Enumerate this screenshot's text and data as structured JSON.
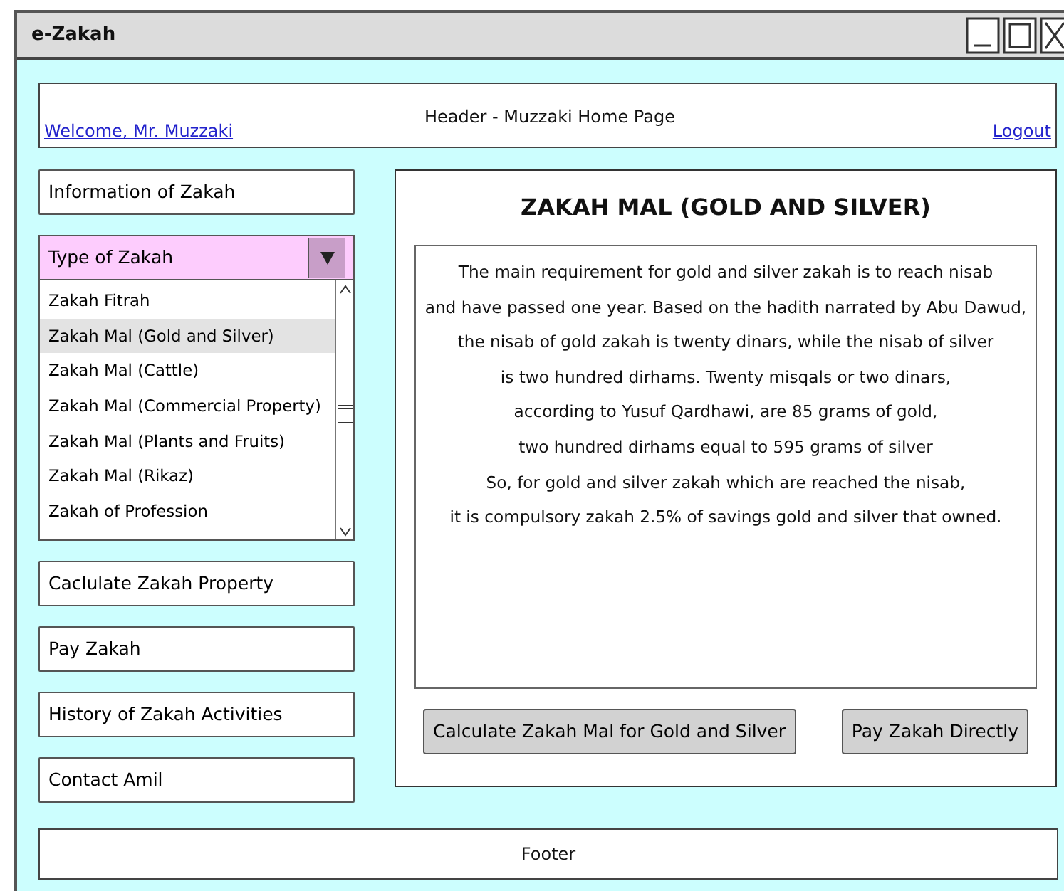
{
  "window": {
    "title": "e-Zakah"
  },
  "header": {
    "welcome_link": "Welcome, Mr. Muzzaki",
    "title": "Header - Muzzaki Home Page",
    "logout_link": "Logout"
  },
  "sidebar": {
    "items": [
      {
        "kind": "button",
        "label": "Information of Zakah"
      },
      {
        "kind": "dropdown",
        "label": "Type of Zakah",
        "expanded": true,
        "options": [
          {
            "label": "Zakah Fitrah",
            "selected": false
          },
          {
            "label": "Zakah Mal (Gold and Silver)",
            "selected": true
          },
          {
            "label": "Zakah Mal (Cattle)",
            "selected": false
          },
          {
            "label": "Zakah Mal (Commercial Property)",
            "selected": false
          },
          {
            "label": "Zakah Mal (Plants and Fruits)",
            "selected": false
          },
          {
            "label": "Zakah Mal (Rikaz)",
            "selected": false
          },
          {
            "label": "Zakah of Profession",
            "selected": false
          }
        ]
      },
      {
        "kind": "button",
        "label": "Caclulate Zakah Property"
      },
      {
        "kind": "button",
        "label": "Pay Zakah"
      },
      {
        "kind": "button",
        "label": "History of Zakah Activities"
      },
      {
        "kind": "button",
        "label": "Contact Amil"
      }
    ]
  },
  "content": {
    "title": "ZAKAH MAL (GOLD AND SILVER)",
    "text_lines": [
      "The main requirement for gold and silver zakah is to reach nisab",
      "and have passed one year. Based on the hadith narrated by Abu Dawud,",
      "the nisab of gold zakah is twenty dinars, while the nisab of silver",
      "is two hundred dirhams. Twenty misqals or two dinars,",
      "according to Yusuf Qardhawi, are 85 grams of gold,",
      "two hundred dirhams equal to 595 grams of silver",
      "So, for gold and silver zakah which are reached the nisab,",
      "it is compulsory zakah 2.5% of savings gold and silver that owned."
    ],
    "buttons": [
      "Calculate Zakah Mal for Gold and Silver",
      "Pay Zakah Directly"
    ]
  },
  "footer": "Footer"
}
